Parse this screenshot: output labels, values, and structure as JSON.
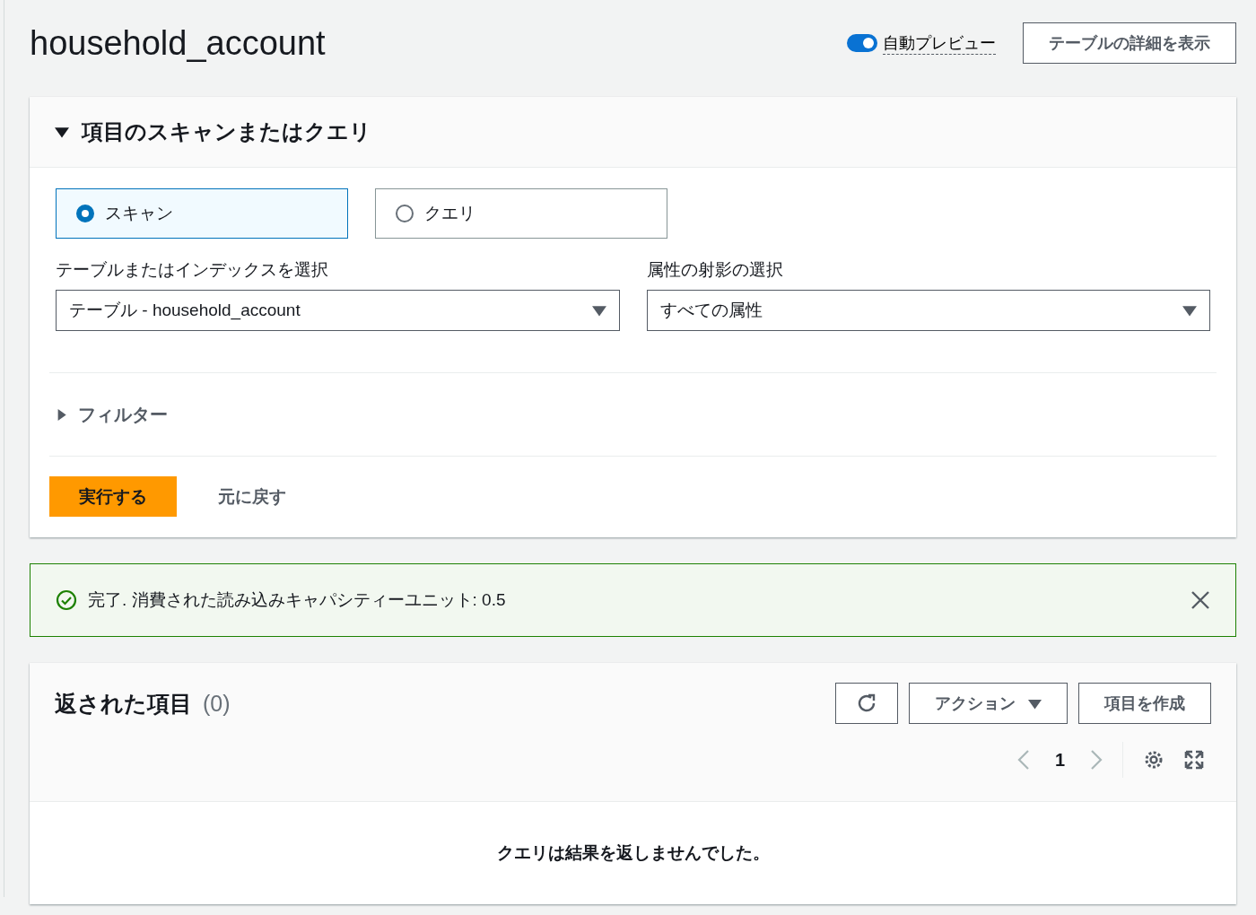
{
  "page": {
    "title": "household_account",
    "auto_preview": {
      "label": "自動プレビュー",
      "on": true
    },
    "details_button": "テーブルの詳細を表示"
  },
  "scan_panel": {
    "title": "項目のスキャンまたはクエリ",
    "expanded": true,
    "modes": [
      {
        "label": "スキャン",
        "selected": true
      },
      {
        "label": "クエリ",
        "selected": false
      }
    ],
    "table_select": {
      "label": "テーブルまたはインデックスを選択",
      "value": "テーブル - household_account"
    },
    "projection_select": {
      "label": "属性の射影の選択",
      "value": "すべての属性"
    },
    "filter": {
      "label": "フィルター",
      "expanded": false
    },
    "run_button": "実行する",
    "reset_button": "元に戻す"
  },
  "alert": {
    "message": "完了. 消費された読み込みキャパシティーユニット: 0.5"
  },
  "results": {
    "title": "返された項目",
    "count": "(0)",
    "action_button": "アクション",
    "create_button": "項目を作成",
    "page": "1",
    "empty_message": "クエリは結果を返しませんでした。"
  }
}
